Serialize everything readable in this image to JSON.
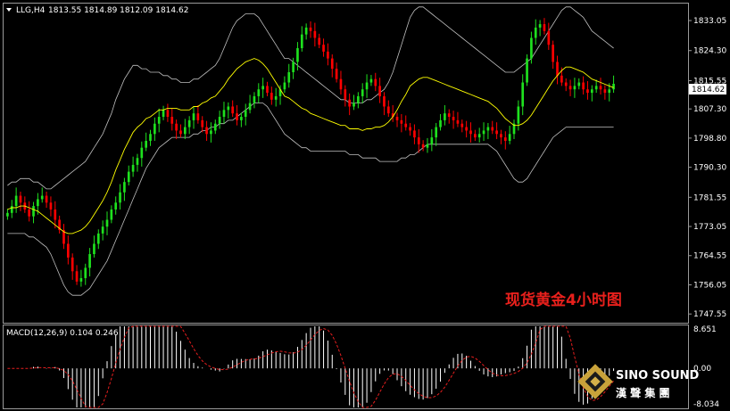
{
  "chart_data": {
    "type": "candlestick",
    "header": {
      "symbol": "LLG,H4",
      "ohlc": "1813.55 1814.89 1812.09 1814.62"
    },
    "title": "现货黄金4小时图",
    "price_ticks": [
      "1833.05",
      "1824.30",
      "1815.55",
      "1807.30",
      "1798.80",
      "1790.30",
      "1781.55",
      "1773.05",
      "1764.55",
      "1756.05",
      "1747.55"
    ],
    "current_price": "1814.62",
    "ylim": [
      1745,
      1838
    ],
    "close": [
      1777,
      1779,
      1782,
      1780,
      1778,
      1776,
      1779,
      1781,
      1782,
      1780,
      1778,
      1775,
      1772,
      1768,
      1764,
      1760,
      1757,
      1758,
      1761,
      1765,
      1768,
      1771,
      1773,
      1775,
      1778,
      1780,
      1783,
      1786,
      1789,
      1791,
      1793,
      1796,
      1798,
      1800,
      1803,
      1805,
      1807,
      1805,
      1803,
      1801,
      1800,
      1802,
      1804,
      1806,
      1804,
      1802,
      1800,
      1801,
      1803,
      1805,
      1807,
      1808,
      1806,
      1804,
      1805,
      1807,
      1809,
      1811,
      1813,
      1814,
      1812,
      1810,
      1811,
      1813,
      1815,
      1818,
      1821,
      1825,
      1829,
      1831,
      1830,
      1828,
      1826,
      1824,
      1822,
      1819,
      1816,
      1813,
      1810,
      1808,
      1809,
      1811,
      1813,
      1815,
      1816,
      1814,
      1811,
      1808,
      1806,
      1805,
      1804,
      1803,
      1802,
      1801,
      1799,
      1797,
      1796,
      1797,
      1799,
      1802,
      1804,
      1806,
      1805,
      1804,
      1803,
      1802,
      1801,
      1800,
      1799,
      1800,
      1801,
      1802,
      1801,
      1800,
      1799,
      1798,
      1800,
      1803,
      1808,
      1815,
      1822,
      1828,
      1831,
      1832,
      1830,
      1826,
      1821,
      1817,
      1815,
      1814,
      1813,
      1814,
      1815,
      1813,
      1812,
      1813,
      1814,
      1813,
      1812,
      1813,
      1814.62
    ],
    "upper_band": [
      1785,
      1786,
      1786,
      1787,
      1787,
      1787,
      1786,
      1786,
      1785,
      1784,
      1784,
      1785,
      1786,
      1787,
      1788,
      1789,
      1790,
      1791,
      1792,
      1794,
      1796,
      1798,
      1800,
      1803,
      1806,
      1810,
      1813,
      1816,
      1818,
      1820,
      1820,
      1819,
      1819,
      1818,
      1818,
      1818,
      1817,
      1817,
      1816,
      1816,
      1815,
      1815,
      1815,
      1816,
      1816,
      1817,
      1818,
      1819,
      1820,
      1822,
      1825,
      1828,
      1831,
      1833,
      1834,
      1835,
      1835,
      1835,
      1834,
      1832,
      1830,
      1828,
      1826,
      1824,
      1822,
      1822,
      1821,
      1820,
      1819,
      1818,
      1817,
      1816,
      1815,
      1814,
      1813,
      1812,
      1811,
      1810,
      1810,
      1809,
      1809,
      1809,
      1809,
      1810,
      1810,
      1811,
      1812,
      1813,
      1815,
      1818,
      1822,
      1826,
      1830,
      1834,
      1836,
      1837,
      1837,
      1836,
      1835,
      1834,
      1833,
      1832,
      1831,
      1830,
      1829,
      1828,
      1827,
      1826,
      1825,
      1824,
      1823,
      1822,
      1821,
      1820,
      1819,
      1818,
      1818,
      1818,
      1819,
      1820,
      1821,
      1822,
      1824,
      1826,
      1828,
      1830,
      1832,
      1834,
      1836,
      1837,
      1837,
      1836,
      1835,
      1834,
      1832,
      1830,
      1829,
      1828,
      1827,
      1826,
      1825
    ],
    "lower_band": [
      1771,
      1771,
      1771,
      1771,
      1771,
      1770,
      1770,
      1769,
      1768,
      1767,
      1765,
      1762,
      1759,
      1756,
      1754,
      1753,
      1753,
      1753,
      1754,
      1755,
      1757,
      1759,
      1761,
      1763,
      1766,
      1769,
      1772,
      1775,
      1778,
      1781,
      1784,
      1787,
      1790,
      1792,
      1794,
      1796,
      1797,
      1798,
      1799,
      1799,
      1799,
      1799,
      1799,
      1800,
      1800,
      1801,
      1801,
      1802,
      1802,
      1803,
      1803,
      1804,
      1804,
      1805,
      1806,
      1807,
      1808,
      1809,
      1809,
      1809,
      1808,
      1806,
      1804,
      1802,
      1800,
      1799,
      1798,
      1797,
      1796,
      1796,
      1795,
      1795,
      1795,
      1795,
      1795,
      1795,
      1795,
      1795,
      1795,
      1794,
      1794,
      1794,
      1793,
      1793,
      1793,
      1793,
      1792,
      1792,
      1792,
      1792,
      1792,
      1793,
      1793,
      1794,
      1794,
      1795,
      1796,
      1797,
      1797,
      1797,
      1797,
      1797,
      1797,
      1797,
      1797,
      1797,
      1797,
      1797,
      1797,
      1797,
      1797,
      1797,
      1796,
      1795,
      1793,
      1791,
      1789,
      1787,
      1786,
      1786,
      1787,
      1789,
      1791,
      1793,
      1795,
      1797,
      1799,
      1800,
      1801,
      1802,
      1802,
      1802,
      1802,
      1802,
      1802,
      1802,
      1802,
      1802,
      1802,
      1802,
      1802
    ],
    "macd": {
      "label": "MACD(12,26,9) 0.104 0.246",
      "ticks": [
        "8.651",
        "0.00",
        "-8.034"
      ],
      "ylim": [
        -8.034,
        8.651
      ]
    },
    "colors": {
      "up": "#1ee11e",
      "down": "#ff0000",
      "mid_line": "#ffff00",
      "band": "#bfbfbf",
      "signal": "#e61e1e",
      "hist": "#ffffff"
    }
  },
  "brand": {
    "name": "SINO SOUND",
    "cn": "漢 聲 集 團"
  }
}
